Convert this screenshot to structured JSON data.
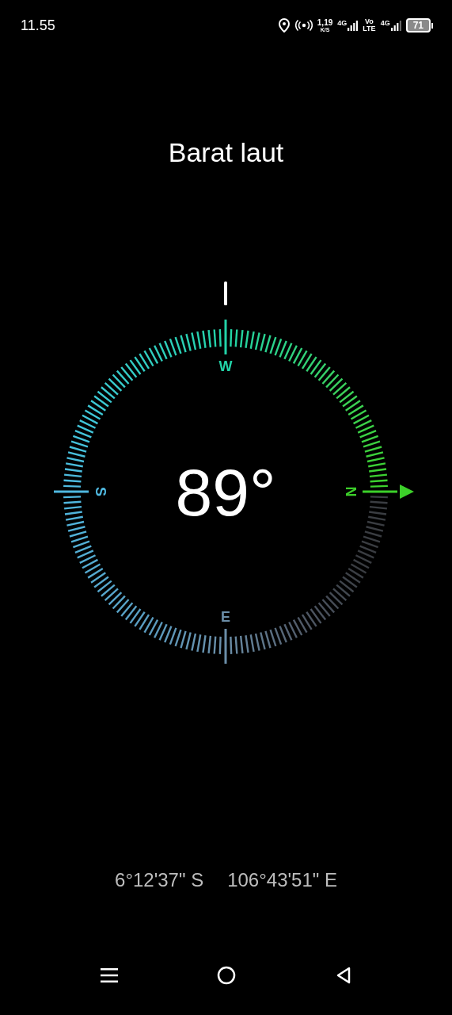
{
  "status_bar": {
    "time": "11.55",
    "speed": "1,19",
    "speed_unit": "K/S",
    "network_1": "4G",
    "volte_top": "Vo",
    "volte_bottom": "LTE",
    "network_2": "4G",
    "battery": "71"
  },
  "title": "Barat laut",
  "heading": "89°",
  "cardinals": [
    {
      "label": "W",
      "color": "#22d3a8"
    },
    {
      "label": "S",
      "color": "#4fb8e0"
    },
    {
      "label": "N",
      "color": "#3ccf2a"
    },
    {
      "label": "E",
      "color": "#6b8ea8"
    }
  ],
  "coordinates": [
    "6°12'37\" S",
    "106°43'51\" E"
  ]
}
